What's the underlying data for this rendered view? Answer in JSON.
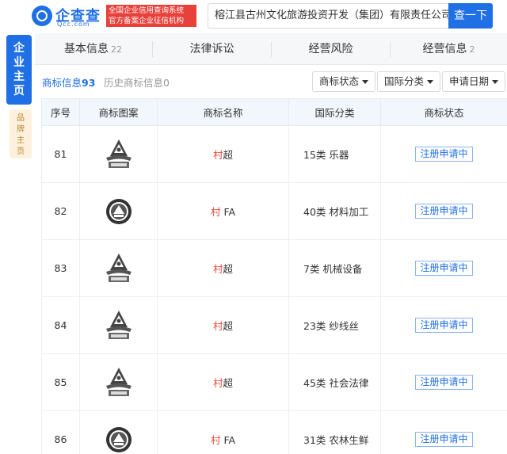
{
  "header": {
    "logo_name": "企查查",
    "logo_domain": "Qcc.com",
    "badge_line1": "全国企业信用查询系统",
    "badge_line2": "官方备案企业征信机构",
    "search_value": "榕江县古州文化旅游投资开发（集团）有限责任公司",
    "search_button": "查一下"
  },
  "side": {
    "main": "企业主页",
    "brand": "品牌主页"
  },
  "tabs": [
    {
      "label": "基本信息",
      "count": "22"
    },
    {
      "label": "法律诉讼",
      "count": ""
    },
    {
      "label": "经营风险",
      "count": ""
    },
    {
      "label": "经营信息",
      "count": "2"
    }
  ],
  "subtabs": {
    "active_label": "商标信息",
    "active_count": "93",
    "history_label": "历史商标信息",
    "history_count": "0"
  },
  "filters": [
    "商标状态",
    "国际分类",
    "申请日期"
  ],
  "table": {
    "headers": [
      "序号",
      "商标图案",
      "商标名称",
      "国际分类",
      "商标状态"
    ],
    "rows": [
      {
        "no": "81",
        "logo": "pagoda",
        "name_hl": "村",
        "name_rest": "超",
        "class": "15类 乐器",
        "status": "注册申请中"
      },
      {
        "no": "82",
        "logo": "round-seal",
        "name_hl": "村",
        "name_rest": " FA",
        "class": "40类 材料加工",
        "status": "注册申请中"
      },
      {
        "no": "83",
        "logo": "pagoda",
        "name_hl": "村",
        "name_rest": "超",
        "class": "7类 机械设备",
        "status": "注册申请中"
      },
      {
        "no": "84",
        "logo": "pagoda",
        "name_hl": "村",
        "name_rest": "超",
        "class": "23类 纱线丝",
        "status": "注册申请中"
      },
      {
        "no": "85",
        "logo": "pagoda",
        "name_hl": "村",
        "name_rest": "超",
        "class": "45类 社会法律",
        "status": "注册申请中"
      },
      {
        "no": "86",
        "logo": "round-seal",
        "name_hl": "村",
        "name_rest": " FA",
        "class": "31类 农林生鲜",
        "status": "注册申请中"
      }
    ]
  },
  "colors": {
    "brand_blue": "#1f6fe5",
    "highlight_red": "#e84b3a",
    "badge_red": "#e8403b"
  }
}
